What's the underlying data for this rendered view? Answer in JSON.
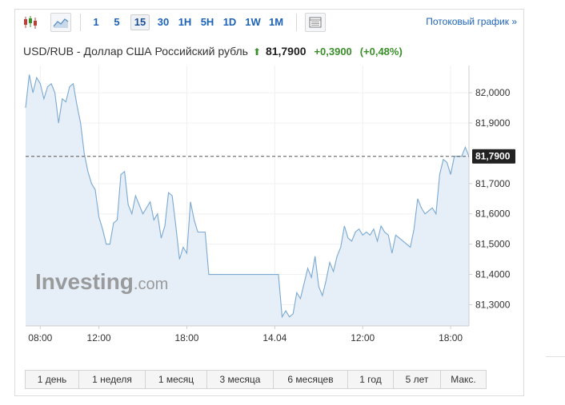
{
  "toolbar": {
    "candles_icon": "candlestick-icon",
    "area_icon": "area-chart-icon",
    "table_icon": "data-table-icon",
    "intervals": [
      "1",
      "5",
      "15",
      "30",
      "1H",
      "5H",
      "1D",
      "1W",
      "1M"
    ],
    "active_interval": "15",
    "stream_link": "Потоковый график »"
  },
  "header": {
    "instrument": "USD/RUB - Доллар США Российский рубль",
    "arrow": "⬆",
    "price": "81,7900",
    "change": "+0,3900",
    "change_pct": "(+0,48%)"
  },
  "colors": {
    "line": "#7aa9d2",
    "fill": "#e6eef7",
    "up": "#3b8f2a",
    "link": "#1c63b8",
    "price_tag_bg": "#222222"
  },
  "watermark": {
    "brand": "Investing",
    "suffix": ".com"
  },
  "chart_data": {
    "type": "area",
    "current_price_label": "81,7900",
    "current_price": 81.79,
    "ylim": [
      81.23,
      82.09
    ],
    "y_ticks": [
      {
        "value": 82.0,
        "label": "82,0000"
      },
      {
        "value": 81.9,
        "label": "81,9000"
      },
      {
        "value": 81.7,
        "label": "81,7000"
      },
      {
        "value": 81.6,
        "label": "81,6000"
      },
      {
        "value": 81.5,
        "label": "81,5000"
      },
      {
        "value": 81.4,
        "label": "81,4000"
      },
      {
        "value": 81.3,
        "label": "81,3000"
      }
    ],
    "x_ticks": [
      {
        "index": 4,
        "label": "08:00"
      },
      {
        "index": 20,
        "label": "12:00"
      },
      {
        "index": 44,
        "label": "18:00"
      },
      {
        "index": 68,
        "label": "14.04"
      },
      {
        "index": 92,
        "label": "12:00"
      },
      {
        "index": 116,
        "label": "18:00"
      }
    ],
    "values": [
      81.95,
      82.06,
      82.0,
      82.05,
      82.03,
      81.98,
      82.02,
      82.03,
      82.0,
      81.9,
      81.98,
      81.97,
      82.02,
      82.03,
      81.96,
      81.9,
      81.8,
      81.74,
      81.7,
      81.68,
      81.59,
      81.55,
      81.5,
      81.5,
      81.57,
      81.58,
      81.73,
      81.74,
      81.63,
      81.6,
      81.66,
      81.63,
      81.6,
      81.62,
      81.64,
      81.58,
      81.6,
      81.52,
      81.56,
      81.67,
      81.66,
      81.56,
      81.45,
      81.49,
      81.47,
      81.64,
      81.58,
      81.54,
      81.54,
      81.54,
      81.4,
      81.4,
      81.4,
      81.4,
      81.4,
      81.4,
      81.4,
      81.4,
      81.4,
      81.4,
      81.4,
      81.4,
      81.4,
      81.4,
      81.4,
      81.4,
      81.4,
      81.4,
      81.4,
      81.4,
      81.26,
      81.28,
      81.26,
      81.27,
      81.34,
      81.32,
      81.37,
      81.42,
      81.39,
      81.46,
      81.36,
      81.33,
      81.38,
      81.44,
      81.41,
      81.46,
      81.49,
      81.56,
      81.52,
      81.51,
      81.54,
      81.55,
      81.53,
      81.54,
      81.53,
      81.55,
      81.51,
      81.56,
      81.54,
      81.53,
      81.47,
      81.53,
      81.52,
      81.51,
      81.5,
      81.49,
      81.55,
      81.65,
      81.62,
      81.6,
      81.61,
      81.62,
      81.6,
      81.73,
      81.78,
      81.77,
      81.73,
      81.79,
      81.79,
      81.79,
      81.82,
      81.79
    ]
  },
  "ranges": [
    "1 день",
    "1 неделя",
    "1 месяц",
    "3 месяца",
    "6 месяцев",
    "1 год",
    "5 лет",
    "Макс."
  ]
}
